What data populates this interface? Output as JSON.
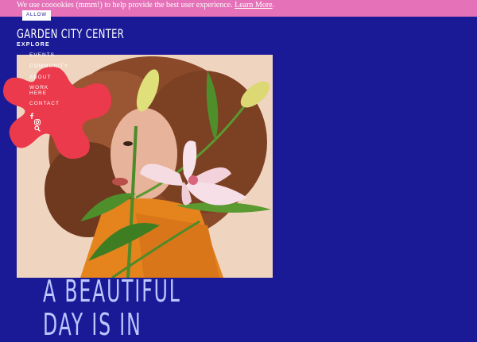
{
  "cookie": {
    "message": "We use cooookies (mmm!) to help provide the best user experience.",
    "link_label": "Learn More",
    "period": ".",
    "allow_label": "ALLOW"
  },
  "header": {
    "brand": "GARDEN CITY CENTER",
    "explore_label": "EXPLORE"
  },
  "nav": {
    "items": [
      {
        "label": "EVENTS"
      },
      {
        "label": "COMMUNITY"
      },
      {
        "label": "ABOUT"
      },
      {
        "label": "WORK HERE"
      },
      {
        "label": "CONTACT"
      }
    ],
    "social": [
      {
        "icon": "facebook-icon"
      },
      {
        "icon": "instagram-icon"
      },
      {
        "icon": "search-icon"
      }
    ]
  },
  "hero": {
    "headline_line1": "A BEAUTIFUL",
    "headline_line2": "DAY IS IN"
  },
  "colors": {
    "background": "#1a1a96",
    "cookie_bar": "#e571b8",
    "blob": "#ea3a4c",
    "headline": "#bcc6ff"
  }
}
